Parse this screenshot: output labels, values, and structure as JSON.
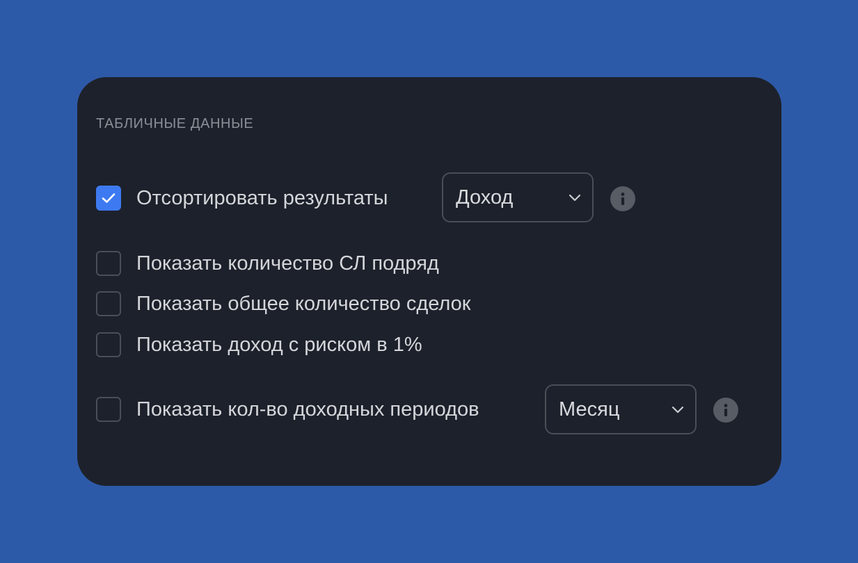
{
  "section": {
    "title": "ТАБЛИЧНЫЕ ДАННЫЕ"
  },
  "options": {
    "sort_results": {
      "label": "Отсортировать результаты",
      "checked": true,
      "select_value": "Доход"
    },
    "show_sl_streak": {
      "label": "Показать количество СЛ подряд",
      "checked": false
    },
    "show_total_trades": {
      "label": "Показать общее количество сделок",
      "checked": false
    },
    "show_income_risk": {
      "label": "Показать доход с риском в 1%",
      "checked": false
    },
    "show_profit_periods": {
      "label": "Показать кол-во доходных периодов",
      "checked": false,
      "select_value": "Месяц"
    }
  },
  "icons": {
    "check": "check-icon",
    "chevron": "chevron-down-icon",
    "info": "info-icon"
  },
  "colors": {
    "background": "#2d5aa8",
    "panel": "#1d212b",
    "accent": "#3d7af1",
    "text": "#d4d6da",
    "muted": "#8a8f98"
  }
}
